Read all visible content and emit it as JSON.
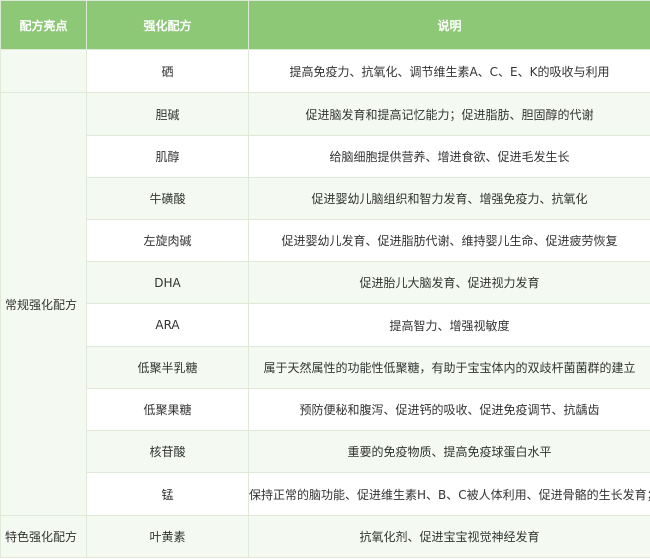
{
  "table": {
    "headers": [
      "配方亮点",
      "强化配方",
      "说明"
    ],
    "groups": [
      {
        "label": "",
        "rows": [
          {
            "name": "硒",
            "desc": "提高免疫力、抗氧化、调节维生素A、C、E、K的吸收与利用"
          }
        ]
      },
      {
        "label": "常规强化配方",
        "rows": [
          {
            "name": "胆碱",
            "desc": "促进脑发育和提高记忆能力；促进脂肪、胆固醇的代谢"
          },
          {
            "name": "肌醇",
            "desc": "给脑细胞提供营养、增进食欲、促进毛发生长"
          },
          {
            "name": "牛磺酸",
            "desc": "促进婴幼儿脑组织和智力发育、增强免疫力、抗氧化"
          },
          {
            "name": "左旋肉碱",
            "desc": "促进婴幼儿发育、促进脂肪代谢、维持婴儿生命、促进疲劳恢复"
          },
          {
            "name": "DHA",
            "desc": "促进胎儿大脑发育、促进视力发育"
          },
          {
            "name": "ARA",
            "desc": "提高智力、增强视敏度"
          },
          {
            "name": "低聚半乳糖",
            "desc": "属于天然属性的功能性低聚糖，有助于宝宝体内的双歧杆菌菌群的建立"
          },
          {
            "name": "低聚果糖",
            "desc": "预防便秘和腹泻、促进钙的吸收、促进免疫调节、抗龋齿"
          },
          {
            "name": "核苷酸",
            "desc": "重要的免疫物质、提高免疫球蛋白水平"
          },
          {
            "name": "锰",
            "desc": "保持正常的脑功能、促进维生素H、B、C被人体利用、促进骨骼的生长发育；"
          }
        ]
      },
      {
        "label": "特色强化配方",
        "rows": [
          {
            "name": "叶黄素",
            "desc": "抗氧化剂、促进宝宝视觉神经发育"
          }
        ]
      }
    ]
  }
}
